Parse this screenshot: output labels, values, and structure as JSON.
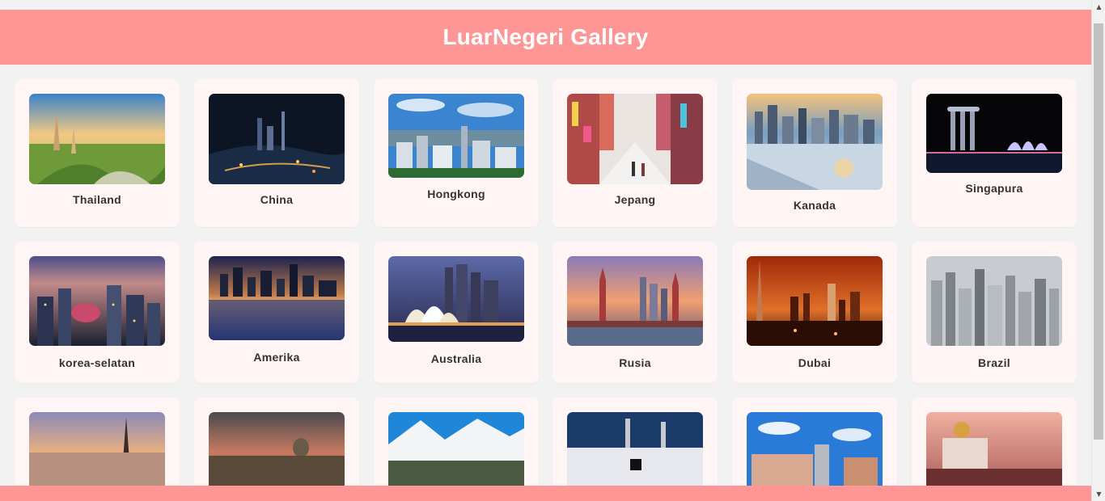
{
  "header": {
    "title": "LuarNegeri Gallery"
  },
  "gallery": {
    "row1": [
      {
        "label": "Thailand",
        "icon": "photo-thailand"
      },
      {
        "label": "China",
        "icon": "photo-china"
      },
      {
        "label": "Hongkong",
        "icon": "photo-hongkong"
      },
      {
        "label": "Jepang",
        "icon": "photo-jepang"
      },
      {
        "label": "Kanada",
        "icon": "photo-kanada"
      },
      {
        "label": "Singapura",
        "icon": "photo-singapura"
      }
    ],
    "row2": [
      {
        "label": "korea-selatan",
        "icon": "photo-korea-selatan"
      },
      {
        "label": "Amerika",
        "icon": "photo-amerika"
      },
      {
        "label": "Australia",
        "icon": "photo-australia"
      },
      {
        "label": "Rusia",
        "icon": "photo-rusia"
      },
      {
        "label": "Dubai",
        "icon": "photo-dubai"
      },
      {
        "label": "Brazil",
        "icon": "photo-brazil"
      }
    ],
    "row3": [
      {
        "icon": "photo-paris"
      },
      {
        "icon": "photo-vatican"
      },
      {
        "icon": "photo-switzerland"
      },
      {
        "icon": "photo-mecca"
      },
      {
        "icon": "photo-mumbai"
      },
      {
        "icon": "photo-brunei"
      }
    ]
  },
  "colors": {
    "header_bg": "#ff9696",
    "page_bg": "#f2f2f2",
    "card_bg": "#fff5f4",
    "label_text": "#333333"
  }
}
